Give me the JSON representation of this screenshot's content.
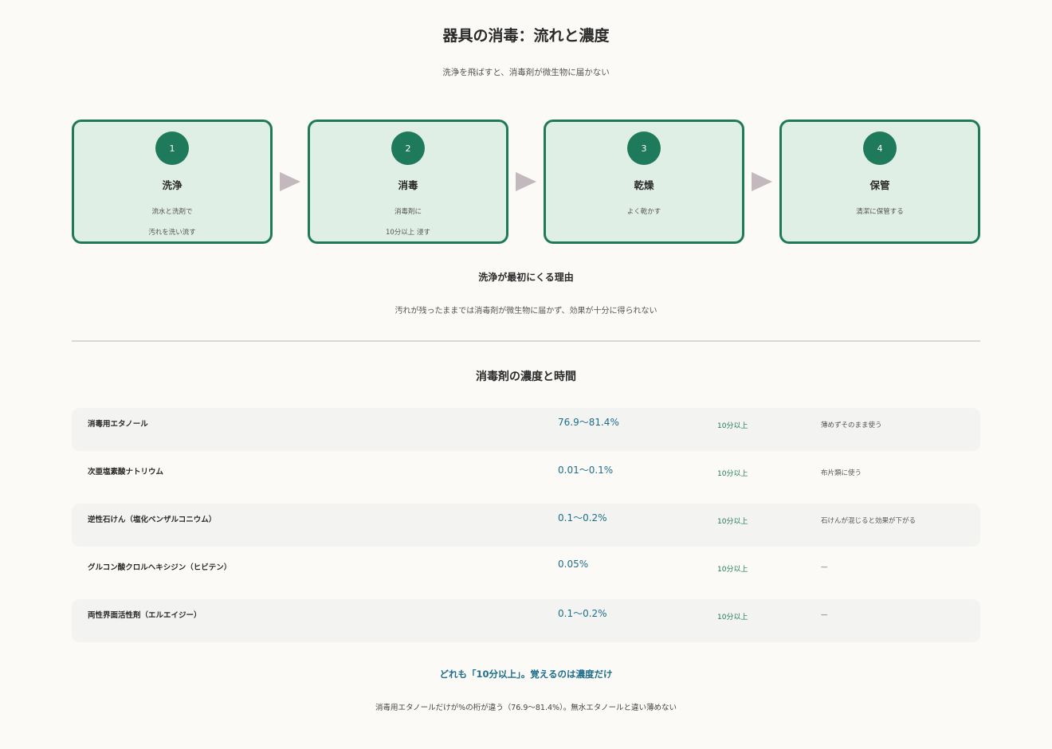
{
  "title": "器具の消毒：流れと濃度",
  "subtitle": "洗浄を飛ばすと、消毒剤が微生物に届かない",
  "steps": [
    {
      "num": "1",
      "title": "洗浄",
      "line1": "流水と洗剤で",
      "line2": "汚れを洗い流す"
    },
    {
      "num": "2",
      "title": "消毒",
      "line1": "消毒剤に",
      "line2": "10分以上 浸す"
    },
    {
      "num": "3",
      "title": "乾燥",
      "line1": "よく乾かす",
      "line2": ""
    },
    {
      "num": "4",
      "title": "保管",
      "line1": "清潔に保管する",
      "line2": ""
    }
  ],
  "reason": {
    "title": "洗浄が最初にくる理由",
    "text": "汚れが残ったままでは消毒剤が微生物に届かず、効果が十分に得られない"
  },
  "table": {
    "title": "消毒剤の濃度と時間",
    "rows": [
      {
        "name": "消毒用エタノール",
        "concentration": "76.9〜81.4%",
        "time": "10分以上",
        "note": "薄めずそのまま使う"
      },
      {
        "name": "次亜塩素酸ナトリウム",
        "concentration": "0.01〜0.1%",
        "time": "10分以上",
        "note": "布片類に使う"
      },
      {
        "name": "逆性石けん（塩化ベンザルコニウム）",
        "concentration": "0.1〜0.2%",
        "time": "10分以上",
        "note": "石けんが混じると効果が下がる"
      },
      {
        "name": "グルコン酸クロルヘキシジン（ヒビテン）",
        "concentration": "0.05%",
        "time": "10分以上",
        "note": "—"
      },
      {
        "name": "両性界面活性剤（エルエイジー）",
        "concentration": "0.1〜0.2%",
        "time": "10分以上",
        "note": "—"
      }
    ]
  },
  "footer": {
    "title": "どれも「10分以上」。覚えるのは濃度だけ",
    "text": "消毒用エタノールだけが%の桁が違う（76.9〜81.4%）。無水エタノールと違い薄めない"
  },
  "colors": {
    "accent_green": "#1f7a5c",
    "card_fill": "#e0efe5",
    "accent_blue": "#1d6e8c",
    "arrow": "#c2b8bd"
  },
  "icons": [
    "arrow-right-icon"
  ]
}
